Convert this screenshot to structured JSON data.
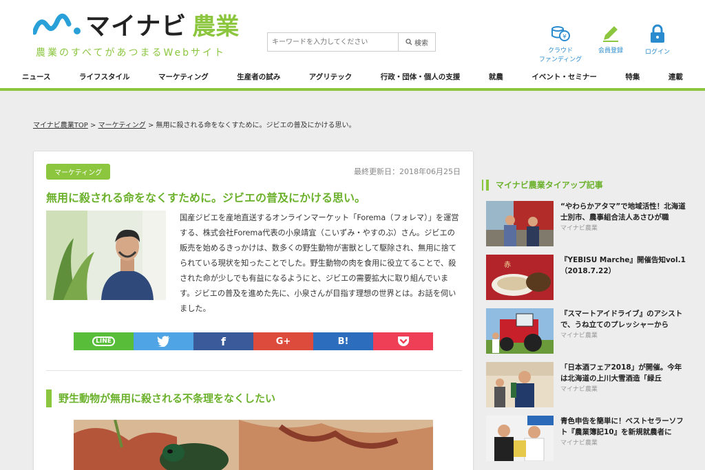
{
  "header": {
    "logo_text": "マイナビ",
    "logo_green": "農業",
    "tagline": "農業のすべてがあつまるWebサイト",
    "search_placeholder": "キーワードを入力してください",
    "search_button": "検索",
    "icons": [
      {
        "label": "クラウド\nファンディング",
        "icon": "coin-stack-icon"
      },
      {
        "label": "会員登録",
        "icon": "pencil-icon"
      },
      {
        "label": "ログイン",
        "icon": "lock-icon"
      }
    ],
    "nav": [
      "ニュース",
      "ライフスタイル",
      "マーケティング",
      "生産者の試み",
      "アグリテック",
      "行政・団体・個人の支援",
      "就農",
      "イベント・セミナー",
      "特集",
      "連載"
    ]
  },
  "breadcrumb": {
    "home": "マイナビ農業TOP",
    "sep": ">",
    "category": "マーケティング",
    "current": "無用に殺される命をなくすために。ジビエの普及にかける思い。"
  },
  "article": {
    "category": "マーケティング",
    "updated": "最終更新日：2018年06月25日",
    "title": "無用に殺される命をなくすために。ジビエの普及にかける思い。",
    "lead": "国産ジビエを産地直送するオンラインマーケット「Forema（フォレマ）」を運営する、株式会社Forema代表の小泉靖宜（こいずみ・やすのぶ）さん。ジビエの販売を始めるきっかけは、数多くの野生動物が害獣として駆除され、無用に捨てられている現状を知ったことでした。野生動物の肉を食用に役立てることで、殺された命が少しでも有益になるようにと、ジビエの需要拡大に取り組んでいます。ジビエの普及を進めた先に、小泉さんが目指す理想の世界とは。お話を伺いました。",
    "share": [
      "LINE",
      "twitter",
      "f",
      "G+",
      "B!",
      "pocket"
    ],
    "section_heading": "野生動物が無用に殺される不条理をなくしたい"
  },
  "sidebar": {
    "heading": "マイナビ農業タイアップ記事",
    "items": [
      {
        "title": "“やわらかアタマ”で地域活性！北海道士別市、農事組合法人あさひが職",
        "source": "マイナビ農業"
      },
      {
        "title": "『YEBISU Marche』開催告知vol.1（2018.7.22）",
        "source": ""
      },
      {
        "title": "『スマートアイドライブ』のアシストで、うね立てのプレッシャーから",
        "source": "マイナビ農業"
      },
      {
        "title": "「日本酒フェア2018」が開催。今年は北海道の上川大雪酒造「緑丘",
        "source": "マイナビ農業"
      },
      {
        "title": "青色申告を簡単に！ベストセラーソフト『農業簿記10』を新規就農者に",
        "source": "マイナビ農業"
      }
    ]
  },
  "colors": {
    "accent": "#8cc63f",
    "title_green": "#6bb12c",
    "link_blue": "#2a8ccf"
  }
}
